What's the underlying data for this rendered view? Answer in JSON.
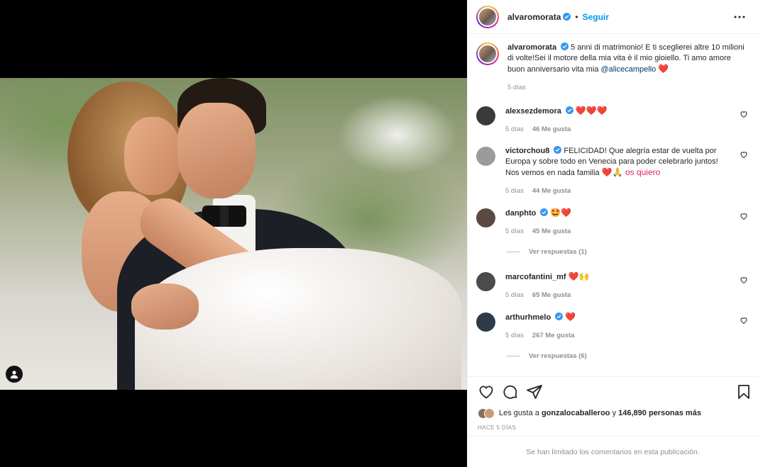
{
  "post": {
    "username": "alvaromorata",
    "follow_label": "Seguir",
    "separator": "•",
    "caption": "5 anni di matrimonio! E ti sceglierei altre 10 milioni di volte!Sei il motore della mia vita è il mio gioiello. Ti amo amore buon anniversario vita mia ",
    "caption_mention": "@alicecampello",
    "caption_emoji": "❤️",
    "caption_time": "5 días"
  },
  "comments": [
    {
      "username": "alexsezdemora",
      "text": "",
      "emoji": "❤️❤️❤️",
      "time": "5 días",
      "likes": "46 Me gusta",
      "avatar_color": "#3a3a3a"
    },
    {
      "username": "victorchou8",
      "text": "FELICIDAD! Que alegría estar de vuelta por Europa y sobre todo en Venecia para poder celebrarlo juntos! Nos vemos en nada familia ",
      "emoji": "❤️🙏 os quiero",
      "time": "5 días",
      "likes": "44 Me gusta",
      "avatar_color": "#9b9b9b"
    },
    {
      "username": "danphto",
      "text": "",
      "emoji": "🤩❤️",
      "time": "5 días",
      "likes": "45 Me gusta",
      "avatar_color": "#5a4a42",
      "replies": "Ver respuestas (1)"
    },
    {
      "username": "marcofantini_mf",
      "text": "",
      "emoji": "❤️🙌",
      "time": "5 días",
      "likes": "65 Me gusta",
      "avatar_color": "#4b4b4b"
    },
    {
      "username": "arthurhmelo",
      "text": "",
      "emoji": "❤️",
      "time": "5 días",
      "likes": "267 Me gusta",
      "avatar_color": "#2d3a48",
      "replies": "Ver respuestas (6)"
    }
  ],
  "likes": {
    "prefix": "Les gusta a ",
    "user": "gonzalocaballeroo",
    "middle": " y ",
    "count": "146,890 personas más"
  },
  "timestamp": "HACE 5 DÍAS",
  "limited_notice": "Se han limitado los comentarios en esta publicación.",
  "icons": [
    "heart-icon",
    "comment-icon",
    "share-icon",
    "bookmark-icon",
    "more-icon",
    "verified-icon",
    "user-tag-icon"
  ],
  "colors": {
    "link": "#0095f6",
    "mention": "#00376b",
    "heart": "#e0245e",
    "muted": "#8e8e8e",
    "verified": "#3897f0"
  }
}
